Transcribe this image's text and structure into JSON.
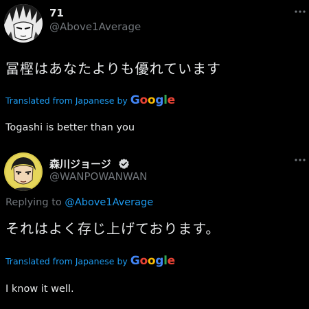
{
  "tweets": [
    {
      "display_name": "71",
      "handle": "@Above1Average",
      "verified": false,
      "text_ja": "冨樫はあなたよりも優れています",
      "translation": {
        "label": "Translated from Japanese by",
        "provider": "Google"
      },
      "text_en": "Togashi is better than you",
      "icons": [
        "avatar-image",
        "more-options-icon"
      ]
    },
    {
      "display_name": "森川ジョージ",
      "handle": "@WANPOWANWAN",
      "verified": true,
      "replying_prefix": "Replying to",
      "replying_to": "@Above1Average",
      "text_ja": "それはよく存じ上げております。",
      "translation": {
        "label": "Translated from Japanese by",
        "provider": "Google"
      },
      "text_en": "I know it well.",
      "icons": [
        "avatar-image",
        "verified-badge-icon",
        "more-options-icon"
      ]
    }
  ],
  "colors": {
    "background": "#000000",
    "primary_text": "#e7e9ea",
    "secondary_text": "#71767b",
    "link": "#1d9bf0",
    "google_blue": "#4285F4",
    "google_red": "#EA4335",
    "google_yellow": "#FBBC05",
    "google_green": "#34A853"
  }
}
